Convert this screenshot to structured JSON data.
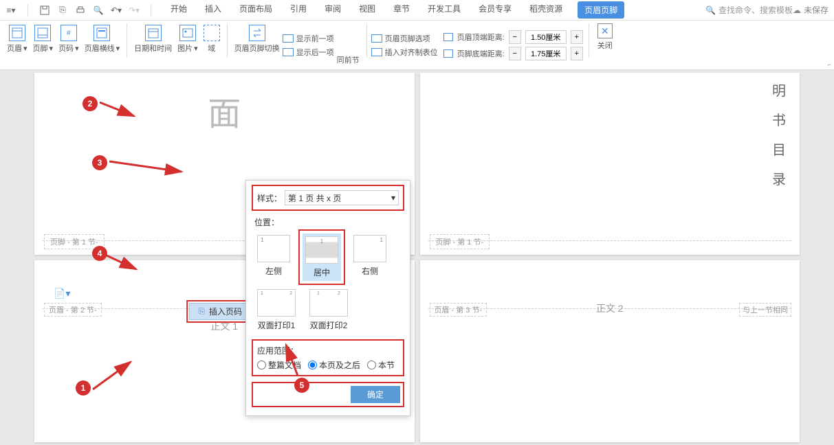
{
  "tabs": {
    "start": "开始",
    "insert": "插入",
    "layout": "页面布局",
    "ref": "引用",
    "review": "审阅",
    "view": "视图",
    "chapter": "章节",
    "dev": "开发工具",
    "member": "会员专享",
    "resource": "稻壳资源",
    "headerfooter": "页眉页脚"
  },
  "search_placeholder": "查找命令、搜索模板",
  "unsaved": "未保存",
  "ribbon": {
    "header": "页眉",
    "footer": "页脚",
    "pagenum": "页码",
    "line": "页眉横线",
    "datetime": "日期和时间",
    "picture": "图片",
    "field": "域",
    "switch": "页眉页脚切换",
    "show_prev": "显示前一项",
    "show_next": "显示后一项",
    "same_section": "同前节",
    "options": "页眉页脚选项",
    "tabstop": "插入对齐制表位",
    "top_dist": "页眉顶端距离:",
    "bottom_dist": "页脚底端距离:",
    "top_val": "1.50厘米",
    "bottom_val": "1.75厘米",
    "close": "关闭"
  },
  "popup": {
    "style_label": "样式：",
    "style_value": "第 1 页 共 x 页",
    "position_label": "位置：",
    "left": "左侧",
    "center": "居中",
    "right": "右侧",
    "duplex1": "双面打印1",
    "duplex2": "双面打印2",
    "scope_label": "应用范围：",
    "scope_all": "整篇文档",
    "scope_after": "本页及之后",
    "scope_section": "本节",
    "confirm": "确定"
  },
  "insert_pill": "插入页码",
  "pages": {
    "footer_s1": "页脚 - 第 1 节-",
    "footer_s1b": "页脚 - 第 1 节-",
    "header_s2": "页眉 - 第 2 节-",
    "header_s3": "页眉 - 第 3 节-",
    "body1": "正文 1",
    "body2": "正文 2",
    "same_prev": "与上一节相同",
    "big_char": "面",
    "vert": [
      "明",
      "书",
      "目",
      "录"
    ]
  },
  "markers": {
    "m1": "1",
    "m2": "2",
    "m3": "3",
    "m4": "4",
    "m5": "5"
  }
}
